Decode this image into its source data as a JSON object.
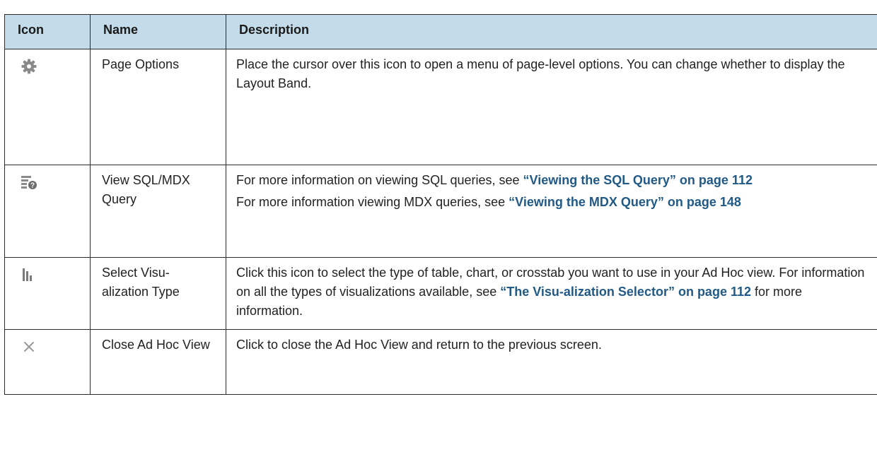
{
  "table": {
    "headers": {
      "icon": "Icon",
      "name": "Name",
      "description": "Description"
    },
    "rows": [
      {
        "icon": "gear-icon",
        "name": "Page Options",
        "desc": [
          {
            "t1": "Place the cursor over this icon to open a menu of page-level options. You can change whether to display the Layout Band."
          }
        ]
      },
      {
        "icon": "query-icon",
        "name": "View SQL/MDX Query",
        "desc": [
          {
            "t1": "For more information on viewing SQL queries, see ",
            "link": "“Viewing the SQL Query” on page 112"
          },
          {
            "t1": "For more information viewing MDX queries, see ",
            "link": "“Viewing the MDX Query” on page 148"
          }
        ]
      },
      {
        "icon": "bar-chart-icon",
        "name": "Select Visu-alization Type",
        "desc": [
          {
            "t1": "Click this icon to select the type of table, chart, or crosstab you want to use in your Ad Hoc view. For information on all the types of visualizations available, see ",
            "link": "“The Visu-alization Selector” on page 112",
            "t2": " for more information."
          }
        ]
      },
      {
        "icon": "close-icon",
        "name": "Close Ad Hoc View",
        "desc": [
          {
            "t1": "Click to close the Ad Hoc View and return to the previous screen."
          }
        ]
      }
    ]
  },
  "colors": {
    "header_bg": "#c4dcea",
    "link": "#215a86",
    "icon_gray": "#8a8a8a",
    "border": "#2b2b2b"
  }
}
